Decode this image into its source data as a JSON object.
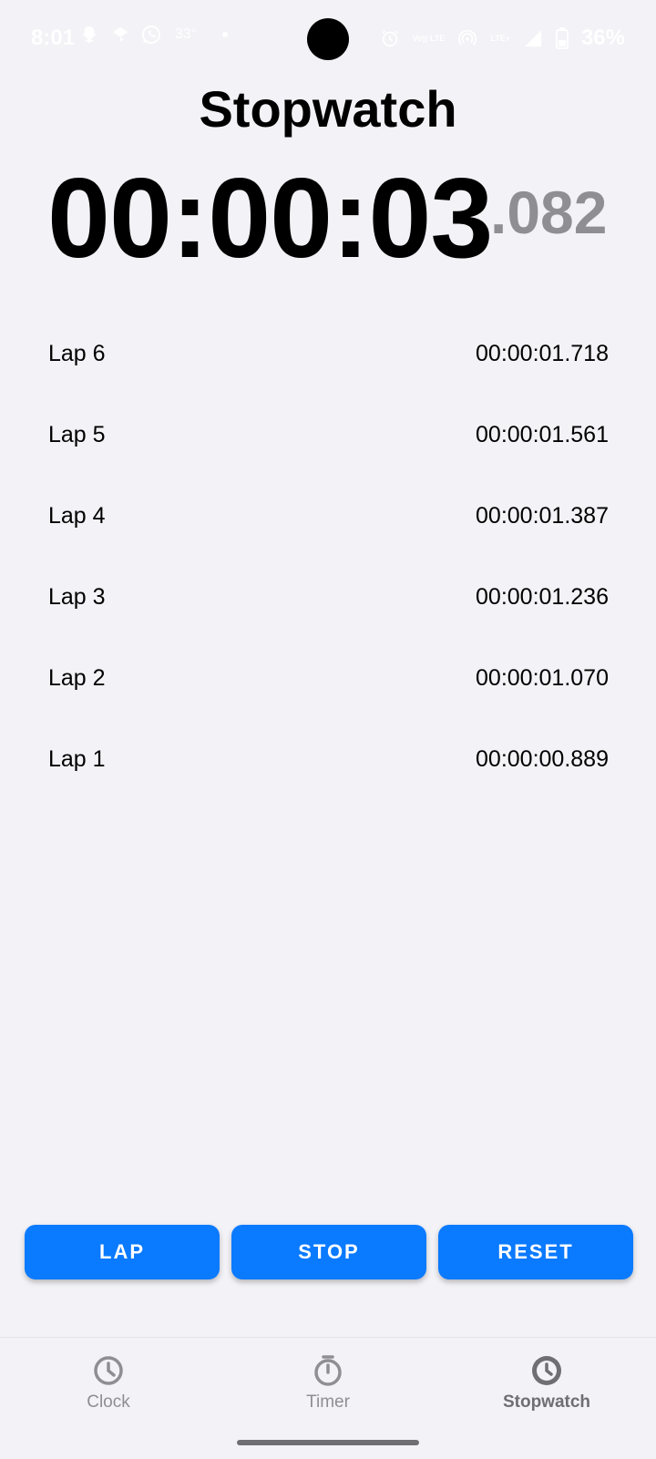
{
  "status_bar": {
    "time": "8:01",
    "temperature": "33°",
    "network_label_1": "Vo)) LTE",
    "network_label_2": "LTE+",
    "battery": "36%",
    "icons": [
      "snapchat-icon",
      "chat-icon",
      "whatsapp-icon",
      "dot-icon",
      "alarm-icon",
      "volte-icon",
      "hotspot-icon",
      "lte-icon",
      "signal-icon",
      "battery-icon"
    ]
  },
  "page": {
    "title": "Stopwatch",
    "time_main": "00:00:03",
    "time_millis": ".082"
  },
  "laps": [
    {
      "label": "Lap 6",
      "time": "00:00:01.718"
    },
    {
      "label": "Lap 5",
      "time": "00:00:01.561"
    },
    {
      "label": "Lap 4",
      "time": "00:00:01.387"
    },
    {
      "label": "Lap 3",
      "time": "00:00:01.236"
    },
    {
      "label": "Lap 2",
      "time": "00:00:01.070"
    },
    {
      "label": "Lap 1",
      "time": "00:00:00.889"
    }
  ],
  "buttons": {
    "lap": "LAP",
    "stop": "STOP",
    "reset": "RESET"
  },
  "nav": {
    "items": [
      {
        "label": "Clock",
        "icon": "clock-icon",
        "active": false
      },
      {
        "label": "Timer",
        "icon": "timer-icon",
        "active": false
      },
      {
        "label": "Stopwatch",
        "icon": "stopwatch-icon",
        "active": true
      }
    ]
  },
  "colors": {
    "background": "#f2f2f7",
    "accent": "#0a7aff",
    "muted": "#8e8e93"
  }
}
